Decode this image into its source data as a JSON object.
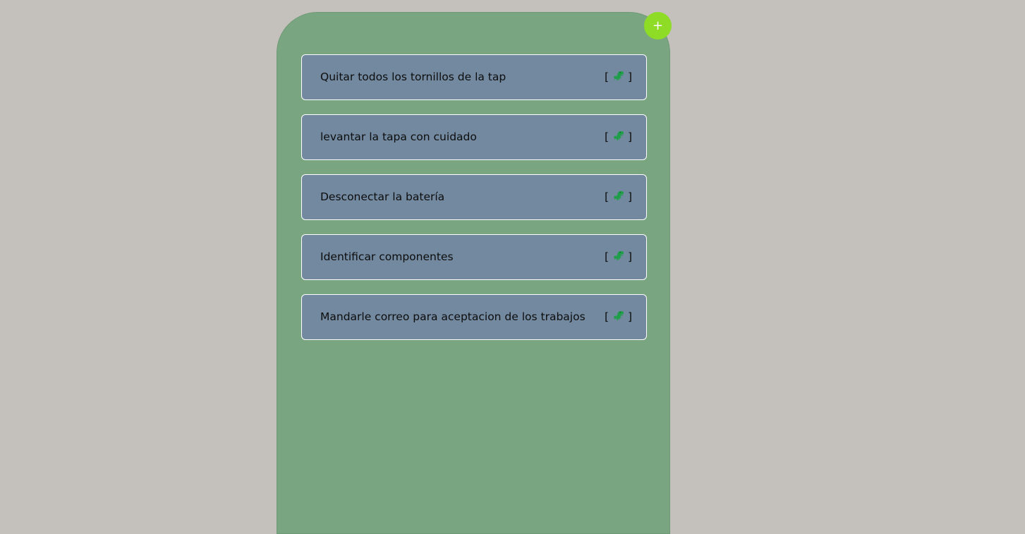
{
  "add_button": {
    "label": "+",
    "color": "#8fdc26"
  },
  "panel": {
    "background": "#79a580"
  },
  "tasks": [
    {
      "label": "Quitar todos los tornillos de la tap",
      "action_open": "[",
      "action_close": "]",
      "icon": "dinosaur-icon"
    },
    {
      "label": "levantar la tapa con cuidado",
      "action_open": "[",
      "action_close": "]",
      "icon": "dinosaur-icon"
    },
    {
      "label": "Desconectar la batería",
      "action_open": "[",
      "action_close": "]",
      "icon": "dinosaur-icon"
    },
    {
      "label": "Identificar componentes",
      "action_open": "[",
      "action_close": "]",
      "icon": "dinosaur-icon"
    },
    {
      "label": "Mandarle correo para aceptacion de los trabajos",
      "action_open": "[",
      "action_close": "]",
      "icon": "dinosaur-icon"
    }
  ]
}
